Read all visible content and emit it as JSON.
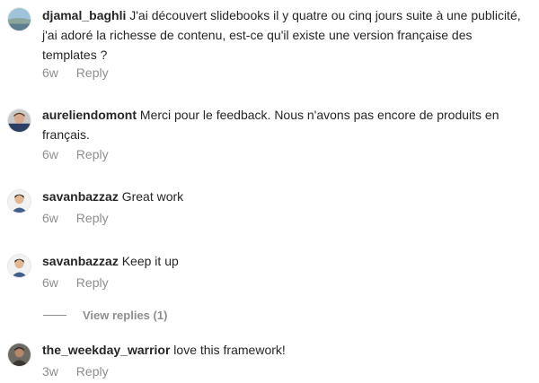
{
  "comments": [
    {
      "username": "djamal_baghli",
      "text": "J'ai découvert slidebooks il y quatre ou cinq jours suite à une publicité, j'ai adoré la richesse de contenu, est-ce qu'il existe une version française des templates ?",
      "time": "6w",
      "reply_label": "Reply",
      "avatar_icon": "landscape-avatar-icon"
    },
    {
      "username": "aureliendomont",
      "text": "Merci pour le feedback. Nous n'avons pas encore de produits en français.",
      "time": "6w",
      "reply_label": "Reply",
      "avatar_icon": "person-avatar-icon"
    },
    {
      "username": "savanbazzaz",
      "text": "Great work",
      "time": "6w",
      "reply_label": "Reply",
      "avatar_icon": "person-avatar-icon"
    },
    {
      "username": "savanbazzaz",
      "text": "Keep it up",
      "time": "6w",
      "reply_label": "Reply",
      "avatar_icon": "person-avatar-icon"
    },
    {
      "username": "the_weekday_warrior",
      "text": "love this framework!",
      "time": "3w",
      "reply_label": "Reply",
      "avatar_icon": "person-avatar-icon"
    }
  ],
  "view_replies_label": "View replies (1)",
  "colors": {
    "text": "#262626",
    "secondary": "#8e8e8e",
    "background": "#ffffff"
  }
}
